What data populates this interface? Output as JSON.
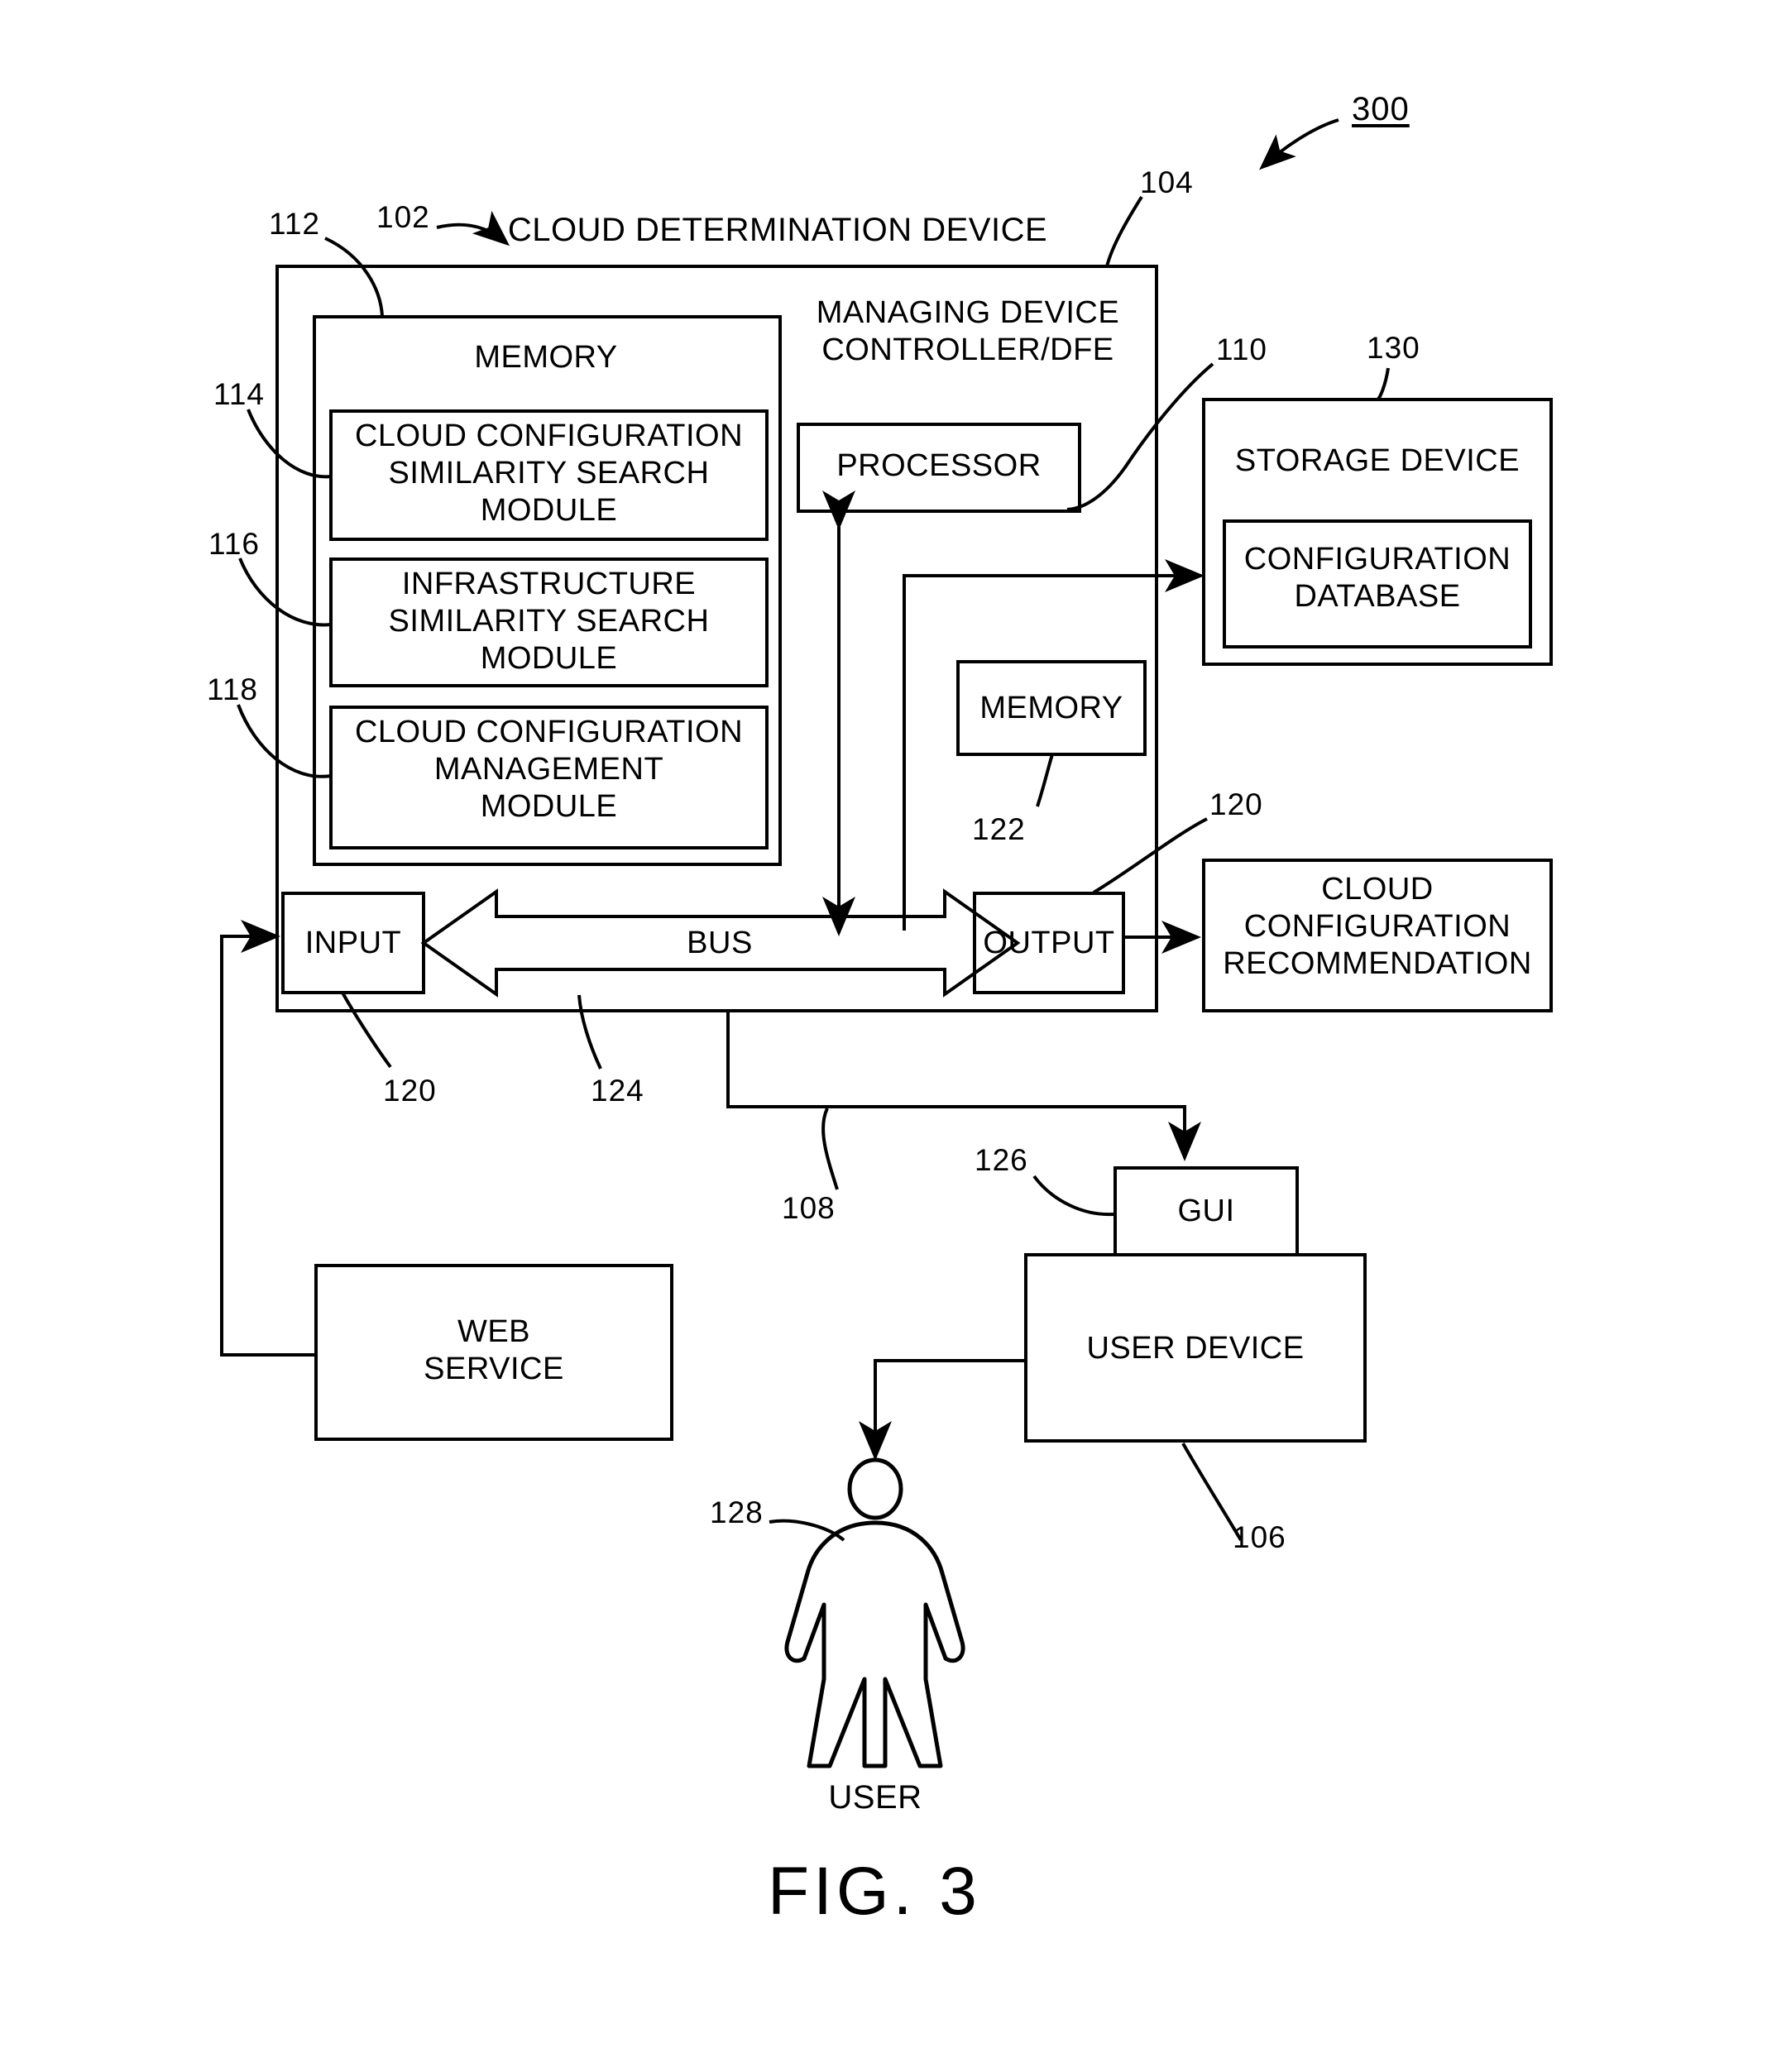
{
  "figure": {
    "title": "FIG. 3",
    "system_ref": "300"
  },
  "boxes": {
    "cloud_determination_device": "CLOUD DETERMINATION DEVICE",
    "managing_device_controller": "MANAGING DEVICE\nCONTROLLER/DFE",
    "memory_main": "MEMORY",
    "cloud_config_similarity_search_module": "CLOUD CONFIGURATION\nSIMILARITY SEARCH\nMODULE",
    "infrastructure_similarity_search_module": "INFRASTRUCTURE\nSIMILARITY SEARCH\nMODULE",
    "cloud_config_management_module": "CLOUD CONFIGURATION\nMANAGEMENT\nMODULE",
    "processor": "PROCESSOR",
    "memory_controller": "MEMORY",
    "storage_device": "STORAGE DEVICE",
    "configuration_database": "CONFIGURATION\nDATABASE",
    "input": "INPUT",
    "output": "OUTPUT",
    "bus": "BUS",
    "cloud_configuration_recommendation": "CLOUD\nCONFIGURATION\nRECOMMENDATION",
    "web_service": "WEB\nSERVICE",
    "gui": "GUI",
    "user_device": "USER DEVICE",
    "user": "USER"
  },
  "reference_numerals": {
    "n102": "102",
    "n104": "104",
    "n106": "106",
    "n108": "108",
    "n110": "110",
    "n112": "112",
    "n114": "114",
    "n116": "116",
    "n118": "118",
    "n120_input": "120",
    "n120_output": "120",
    "n122": "122",
    "n124": "124",
    "n126": "126",
    "n128": "128",
    "n130": "130",
    "n300": "300"
  },
  "style": {
    "line_color": "#000000",
    "background": "#ffffff"
  }
}
